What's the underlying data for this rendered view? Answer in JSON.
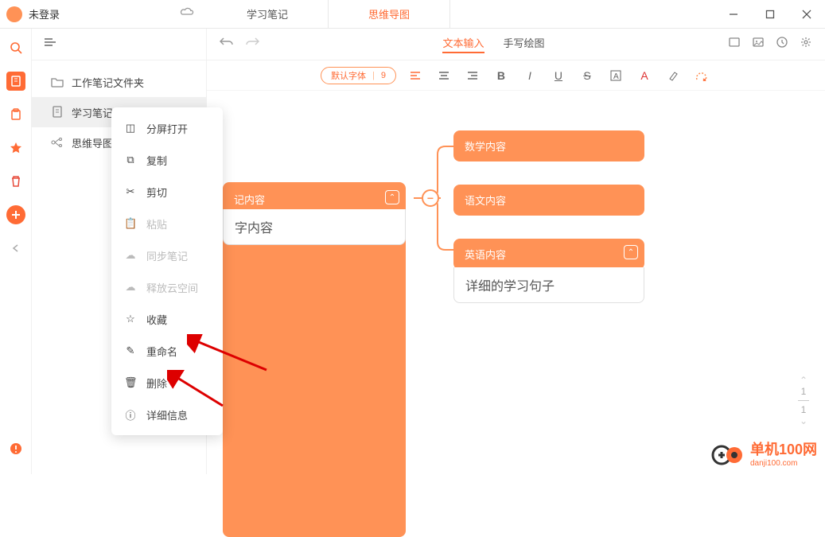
{
  "titlebar": {
    "login": "未登录"
  },
  "tabs": {
    "study": "学习笔记",
    "mindmap": "思维导图"
  },
  "tree": {
    "folder": "工作笔记文件夹",
    "note": "学习笔记",
    "mind": "思维导图"
  },
  "toolbar": {
    "text_input": "文本输入",
    "handwrite": "手写绘图"
  },
  "format": {
    "font": "默认字体",
    "size": "9"
  },
  "mindmap": {
    "root": "记内容",
    "root_sub": "字内容",
    "child1": "数学内容",
    "child2": "语文内容",
    "child3": "英语内容",
    "child3_detail": "详细的学习句子"
  },
  "context_menu": {
    "split": "分屏打开",
    "copy": "复制",
    "cut": "剪切",
    "paste": "粘贴",
    "sync": "同步笔记",
    "release": "释放云空间",
    "fav": "收藏",
    "rename": "重命名",
    "delete": "删除",
    "detail": "详细信息"
  },
  "page": {
    "current": "1",
    "total": "1"
  },
  "watermark": {
    "brand": "单机100网",
    "domain": "danji100.com"
  }
}
